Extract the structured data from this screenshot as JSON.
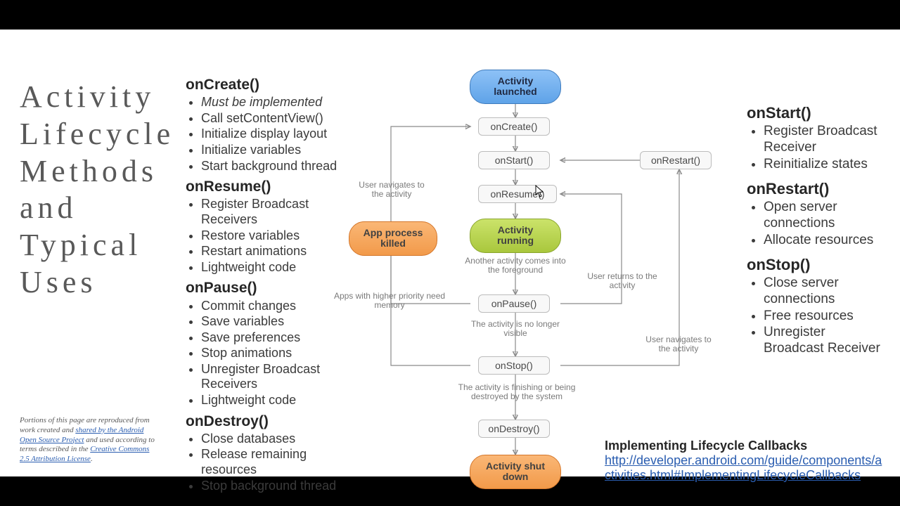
{
  "title": "Activity Lifecycle Methods and Typical Uses",
  "left": {
    "onCreate": {
      "h": "onCreate()",
      "items": [
        "Must be implemented",
        "Call setContentView()",
        "Initialize display layout",
        "Initialize variables",
        "Start background thread"
      ]
    },
    "onResume": {
      "h": "onResume()",
      "items": [
        "Register Broadcast Receivers",
        "Restore variables",
        "Restart animations",
        "Lightweight code"
      ]
    },
    "onPause": {
      "h": "onPause()",
      "items": [
        "Commit changes",
        "Save variables",
        "Save preferences",
        "Stop animations",
        "Unregister Broadcast Receivers",
        "Lightweight code"
      ]
    },
    "onDestroy": {
      "h": "onDestroy()",
      "items": [
        "Close databases",
        "Release remaining resources",
        "Stop background thread"
      ]
    }
  },
  "right": {
    "onStart": {
      "h": "onStart()",
      "items": [
        "Register Broadcast Receiver",
        "Reinitialize states"
      ]
    },
    "onRestart": {
      "h": "onRestart()",
      "items": [
        "Open server connections",
        "Allocate resources"
      ]
    },
    "onStop": {
      "h": "onStop()",
      "items": [
        "Close server connections",
        "Free resources",
        "Unregister Broadcast Receiver"
      ]
    }
  },
  "diagram": {
    "launched": "Activity launched",
    "onCreate": "onCreate()",
    "onStart": "onStart()",
    "onResume": "onResume()",
    "running": "Activity running",
    "onPause": "onPause()",
    "onStop": "onStop()",
    "onDestroy": "onDestroy()",
    "shutdown": "Activity shut down",
    "killed": "App process killed",
    "onRestart": "onRestart()",
    "userNav": "User navigates to the activity",
    "anotherFg": "Another activity comes into the foreground",
    "userReturns": "User returns to the activity",
    "higherPriority": "Apps with higher priority need memory",
    "noLongerVisible": "The activity is no longer visible",
    "userNav2": "User navigates to the activity",
    "finishing": "The activity is finishing or being destroyed by the system"
  },
  "attrib": {
    "p1": "Portions of this page are reproduced from work created and ",
    "a1": "shared by the Android Open Source Project",
    "p2": " and used according to terms described in the ",
    "a2": "Creative Commons 2.5 Attribution License",
    "p3": "."
  },
  "refs": {
    "title": "Implementing  Lifecycle  Callbacks",
    "url": "http://developer.android.com/guide/components/activities.html#ImplementingLifecycleCallbacks"
  }
}
